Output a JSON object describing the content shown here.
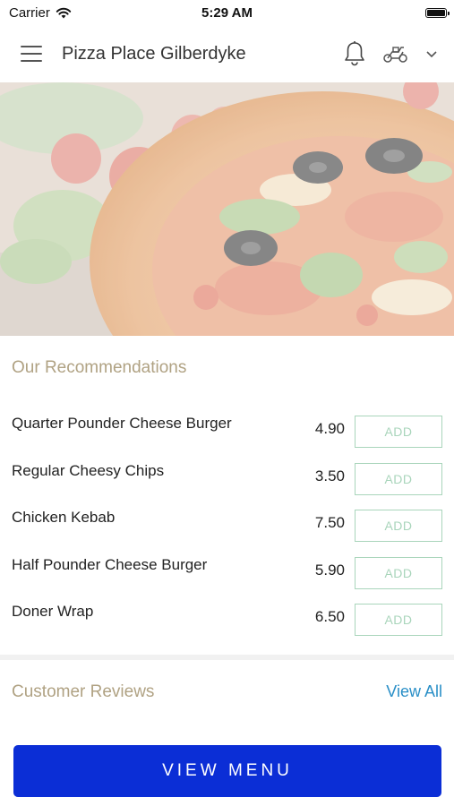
{
  "status_bar": {
    "carrier": "Carrier",
    "time": "5:29 AM"
  },
  "header": {
    "title": "Pizza Place Gilberdyke",
    "icons": [
      "menu-icon",
      "bell-icon",
      "scooter-icon",
      "chevron-down-icon"
    ]
  },
  "recommendations": {
    "title": "Our Recommendations",
    "add_label": "ADD",
    "items": [
      {
        "name": "Quarter Pounder Cheese Burger",
        "price": "4.90"
      },
      {
        "name": "Regular Cheesy Chips",
        "price": "3.50"
      },
      {
        "name": "Chicken Kebab",
        "price": "7.50"
      },
      {
        "name": "Half Pounder Cheese Burger",
        "price": "5.90"
      },
      {
        "name": "Doner Wrap",
        "price": "6.50"
      }
    ]
  },
  "reviews": {
    "title": "Customer Reviews",
    "view_all": "View All"
  },
  "view_menu_label": "VIEW MENU",
  "colors": {
    "accent_gold": "#b0a283",
    "add_green": "#a9d5bb",
    "link_blue": "#2a8fc7",
    "button_blue": "#0b2ed6"
  }
}
